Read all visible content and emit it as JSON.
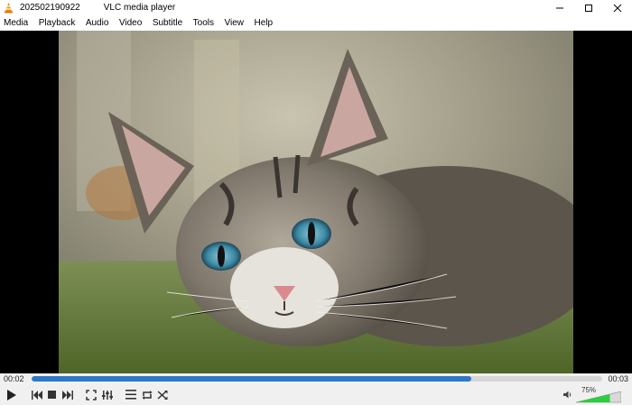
{
  "window": {
    "file_name": "202502190922",
    "app_title": "VLC media player"
  },
  "menu": [
    "Media",
    "Playback",
    "Audio",
    "Video",
    "Subtitle",
    "Tools",
    "View",
    "Help"
  ],
  "playback": {
    "elapsed": "00:02",
    "total": "00:03",
    "progress_fraction": 0.77
  },
  "volume": {
    "percent_label": "75%",
    "level_fraction": 0.75
  },
  "controls": {
    "icons": [
      "play-icon",
      "previous-icon",
      "stop-icon",
      "next-icon",
      "fullscreen-icon",
      "extended-settings-icon",
      "playlist-icon",
      "loop-icon",
      "shuffle-icon",
      "speaker-icon"
    ]
  },
  "colors": {
    "accent": "#2f78c7",
    "volume_green": "#2ecc40",
    "letterbox": "#000000"
  }
}
